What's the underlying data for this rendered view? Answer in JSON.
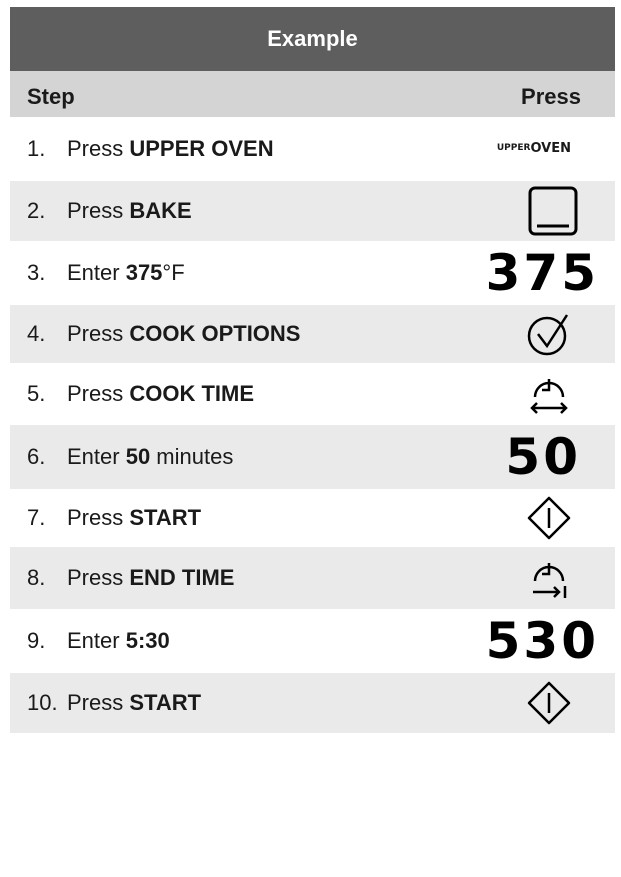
{
  "title": "Example",
  "header": {
    "step": "Step",
    "press": "Press"
  },
  "steps": [
    {
      "num": "1.",
      "prefix": "Press ",
      "bold": "UPPER OVEN",
      "suffix": "",
      "press": {
        "type": "text",
        "line1": "UPPER",
        "line2": "OVEN"
      }
    },
    {
      "num": "2.",
      "prefix": "Press ",
      "bold": "BAKE",
      "suffix": "",
      "press": {
        "type": "icon",
        "icon": "bake-icon"
      }
    },
    {
      "num": "3.",
      "prefix": "Enter ",
      "bold": "375",
      "suffix": "°F",
      "press": {
        "type": "digits",
        "value": "375"
      }
    },
    {
      "num": "4.",
      "prefix": "Press ",
      "bold": "COOK OPTIONS",
      "suffix": "",
      "press": {
        "type": "icon",
        "icon": "check-circle-icon"
      }
    },
    {
      "num": "5.",
      "prefix": "Press ",
      "bold": "COOK TIME",
      "suffix": "",
      "press": {
        "type": "icon",
        "icon": "clock-double-arrow-icon"
      }
    },
    {
      "num": "6.",
      "prefix": "Enter ",
      "bold": "50",
      "suffix": " minutes",
      "press": {
        "type": "digits",
        "value": "50"
      }
    },
    {
      "num": "7.",
      "prefix": "Press ",
      "bold": "START",
      "suffix": "",
      "press": {
        "type": "icon",
        "icon": "start-diamond-icon"
      }
    },
    {
      "num": "8.",
      "prefix": "Press ",
      "bold": "END TIME",
      "suffix": "",
      "press": {
        "type": "icon",
        "icon": "clock-arrow-end-icon"
      }
    },
    {
      "num": "9.",
      "prefix": "Enter ",
      "bold": "5:30",
      "suffix": "",
      "press": {
        "type": "digits",
        "value": "530"
      }
    },
    {
      "num": "10.",
      "prefix": "Press ",
      "bold": "START",
      "suffix": "",
      "press": {
        "type": "icon",
        "icon": "start-diamond-icon"
      }
    }
  ],
  "colors": {
    "title_bg": "#5e5e5e",
    "header_bg": "#d4d4d4",
    "row_alt_bg": "#eaeaea"
  }
}
